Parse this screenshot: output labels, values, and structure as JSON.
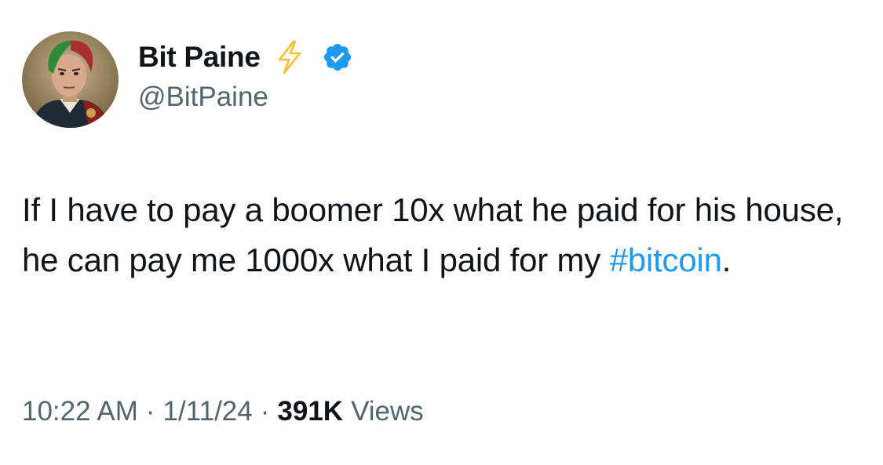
{
  "author": {
    "display_name": "Bit Paine",
    "handle": "@BitPaine",
    "avatar_icon": "avatar-portrait",
    "badges": [
      "lightning-bolt-icon",
      "verified-badge-icon"
    ],
    "verified_color": "#1d9bf0",
    "bolt_color": "#f7c02b"
  },
  "tweet": {
    "text_before": "If I have to pay a boomer 10x what he paid for his house, he can pay me 1000x what I paid for my ",
    "hashtag": "#bitcoin",
    "text_after": "."
  },
  "meta": {
    "time": "10:22 AM",
    "separator_1": "·",
    "date": "1/11/24",
    "separator_2": "·",
    "views_count": "391K",
    "views_label": "Views"
  },
  "colors": {
    "text_primary": "#0f1419",
    "text_secondary": "#536471",
    "link": "#1d9bf0"
  }
}
